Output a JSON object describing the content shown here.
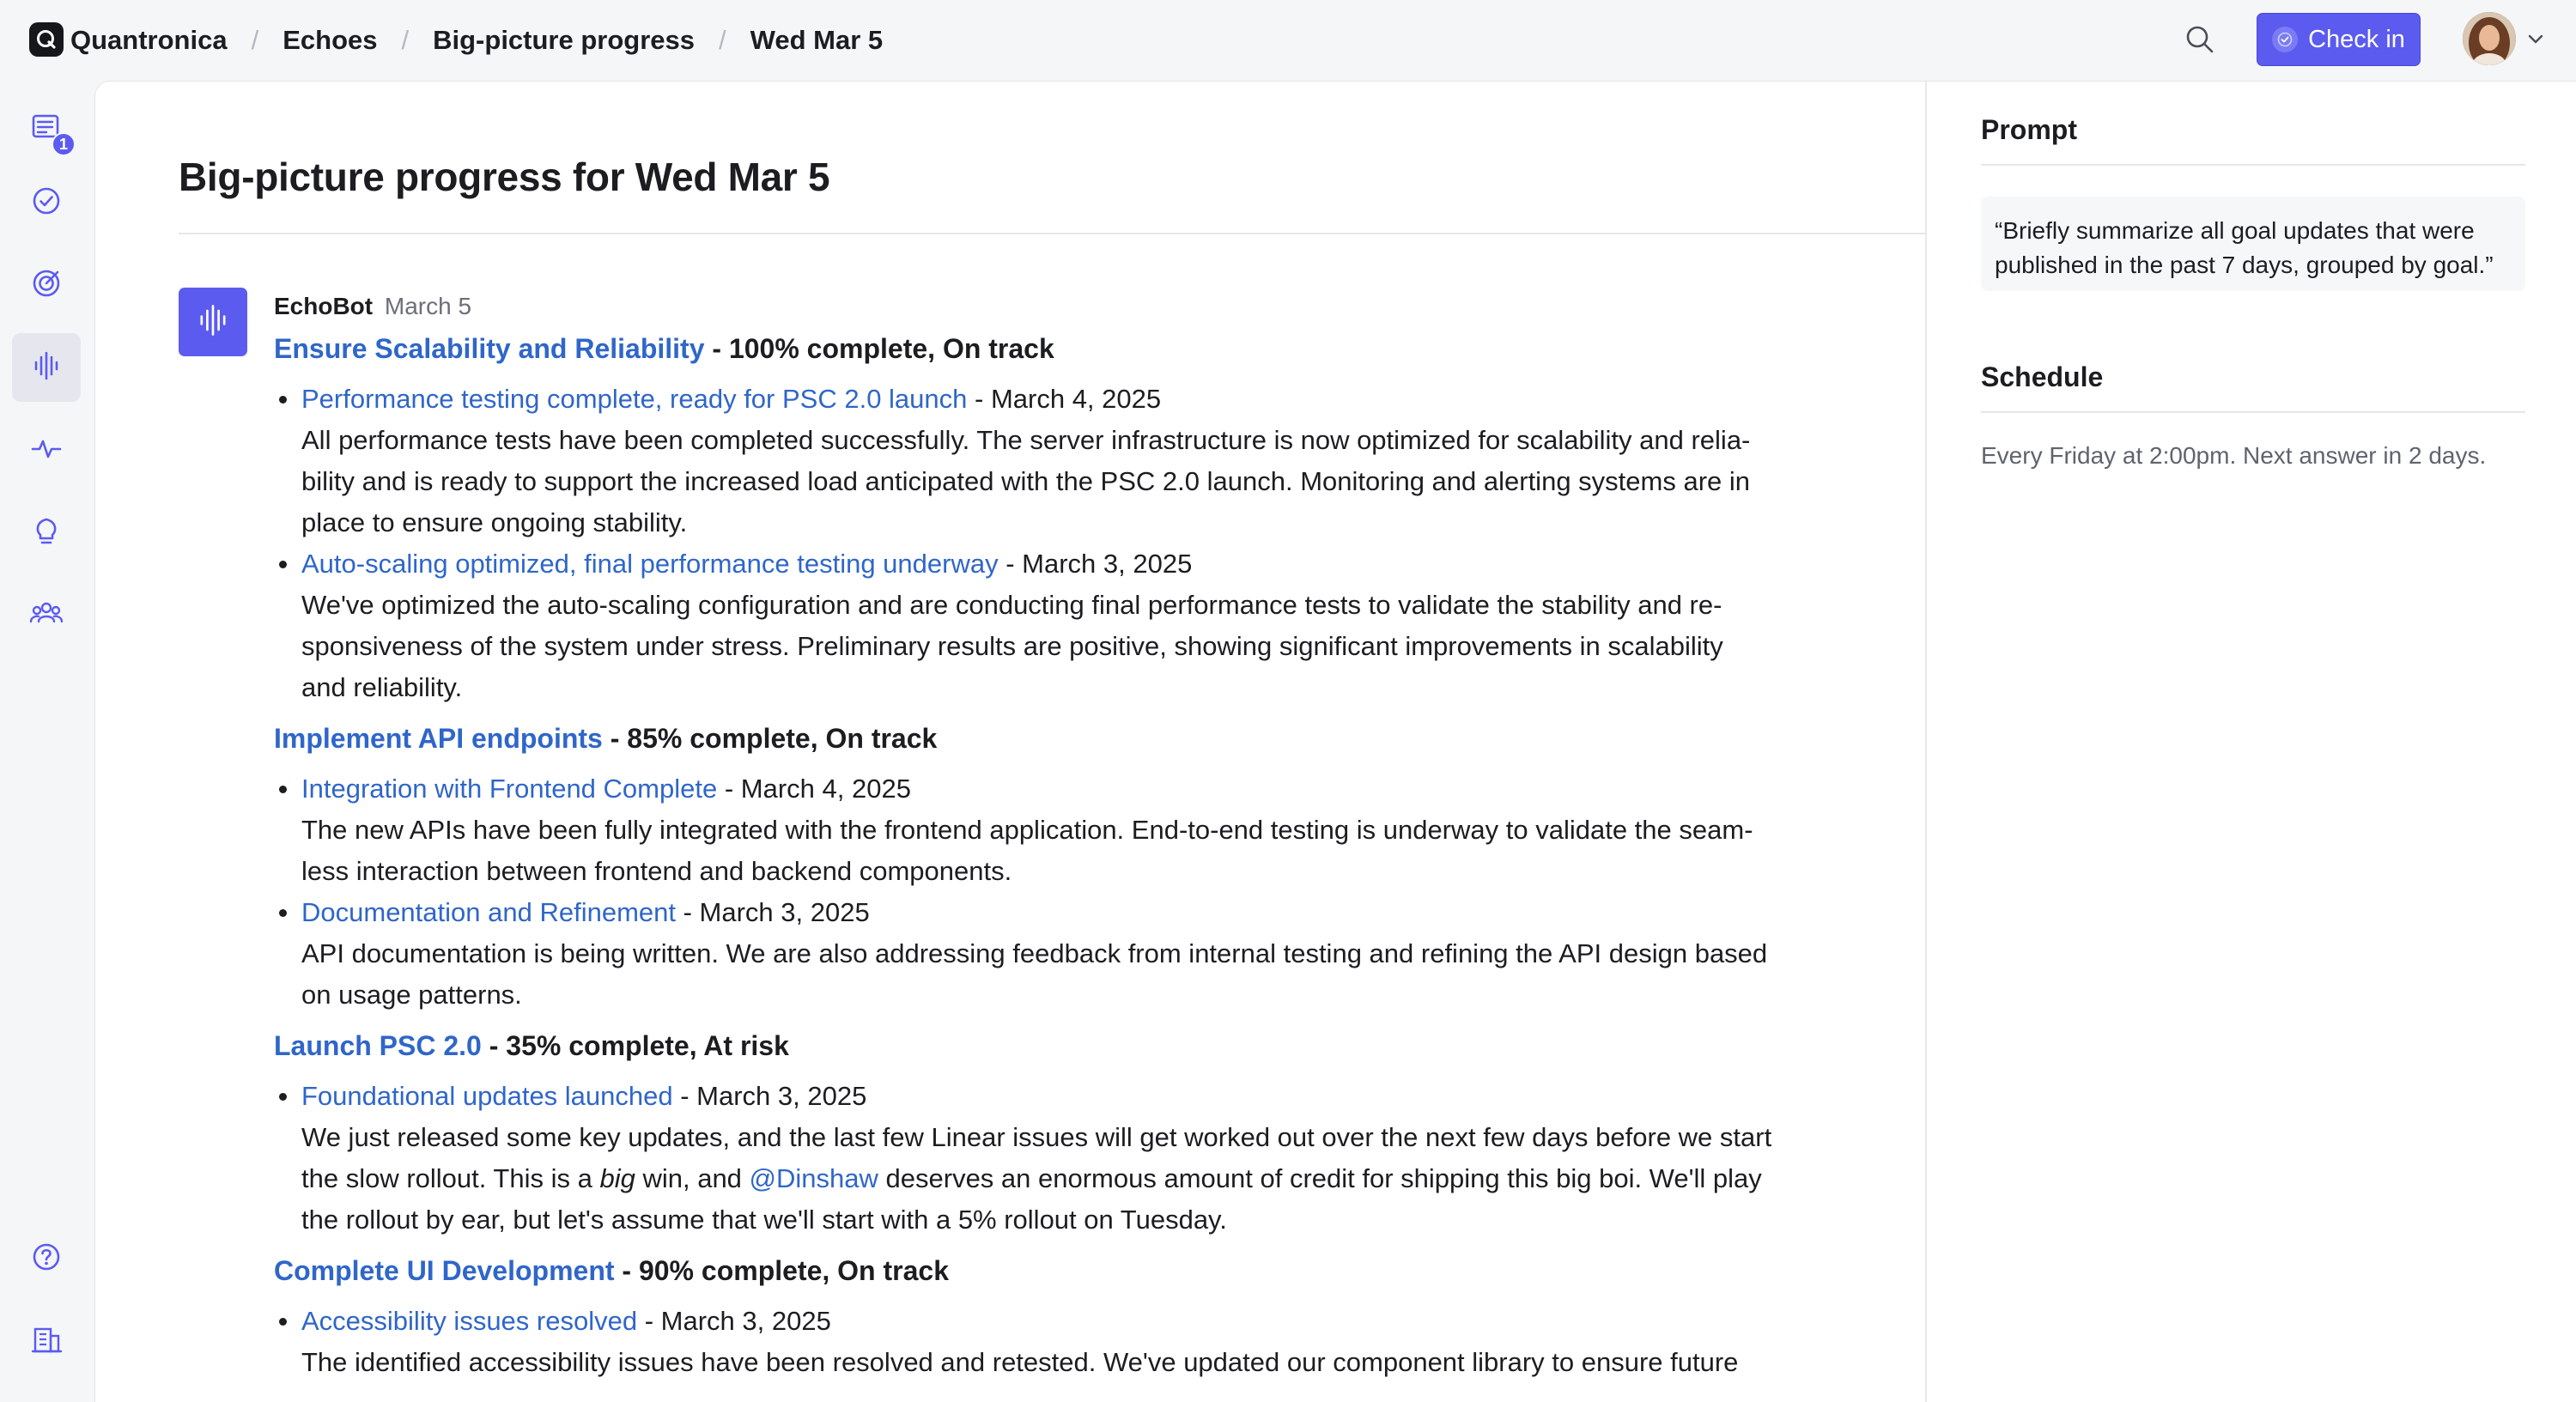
{
  "topbar": {
    "breadcrumbs": [
      "Quantronica",
      "Echoes",
      "Big-picture progress",
      "Wed Mar 5"
    ],
    "check_in_label": "Check in",
    "icons": {
      "logo": "q-logo-icon",
      "search": "search-icon",
      "avatar_menu": "chevron-down-icon"
    }
  },
  "rail": {
    "items": [
      {
        "icon": "inbox-icon",
        "badge": "1"
      },
      {
        "icon": "check-circle-icon"
      },
      {
        "icon": "target-icon"
      },
      {
        "icon": "waveform-icon",
        "active": true
      },
      {
        "icon": "pulse-icon"
      },
      {
        "icon": "lightbulb-icon"
      },
      {
        "icon": "people-icon"
      },
      {
        "icon": "help-icon"
      },
      {
        "icon": "building-icon"
      }
    ]
  },
  "page": {
    "title": "Big-picture progress for Wed Mar 5"
  },
  "post": {
    "author": "EchoBot",
    "date": "March 5",
    "goals": [
      {
        "name": "Ensure Scalability and Reliability",
        "status": " - 100% complete, On track",
        "updates": [
          {
            "title": "Performance testing complete, ready for PSC 2.0 launch",
            "date": " - March 4, 2025",
            "lines": [
              "All performance tests have been completed successfully. The server infrastructure is now optimized for scalability and relia-",
              "bility and is ready to support the increased load anticipated with the PSC 2.0 launch. Monitoring and alerting systems are in",
              "place to ensure ongoing stability."
            ]
          },
          {
            "title": "Auto-scaling optimized, final performance testing underway",
            "date": " - March 3, 2025",
            "lines": [
              "We've optimized the auto-scaling configuration and are conducting final performance tests to validate the stability and re-",
              "sponsiveness of the system under stress. Preliminary results are positive, showing significant improvements in scalability",
              "and reliability."
            ]
          }
        ]
      },
      {
        "name": "Implement API endpoints",
        "status": " - 85% complete, On track",
        "updates": [
          {
            "title": "Integration with Frontend Complete",
            "date": " - March 4, 2025",
            "lines": [
              "The new APIs have been fully integrated with the frontend application. End-to-end testing is underway to validate the seam-",
              "less interaction between frontend and backend components."
            ]
          },
          {
            "title": "Documentation and Refinement",
            "date": " - March 3, 2025",
            "lines": [
              "API documentation is being written. We are also addressing feedback from internal testing and refining the API design based",
              "on usage patterns."
            ]
          }
        ]
      },
      {
        "name": "Launch PSC 2.0",
        "status": " - 35% complete, At risk",
        "updates": [
          {
            "title": "Foundational updates launched",
            "date": " - March 3, 2025",
            "rich": {
              "line1": "We just released some key updates, and the last few Linear issues will get worked out over the next few days before we start",
              "line2_a": "the slow rollout. This is a ",
              "line2_em": "big",
              "line2_b": " win, and ",
              "line2_mention": "@Dinshaw",
              "line2_c": " deserves an enormous amount of credit for shipping this big boi. We'll play",
              "line3": "the rollout by ear, but let's assume that we'll start with a 5% rollout on Tuesday."
            }
          }
        ]
      },
      {
        "name": "Complete UI Development",
        "status": " - 90% complete, On track",
        "updates": [
          {
            "title": "Accessibility issues resolved",
            "date": " - March 3, 2025",
            "lines": [
              "The identified accessibility issues have been resolved and retested. We've updated our component library to ensure future"
            ]
          }
        ]
      }
    ]
  },
  "side": {
    "prompt_heading": "Prompt",
    "prompt_text": "“Briefly summarize all goal updates that were published in the past 7 days, grouped by goal.”",
    "schedule_heading": "Schedule",
    "schedule_text": "Every Friday at 2:00pm. Next answer in 2 days."
  }
}
